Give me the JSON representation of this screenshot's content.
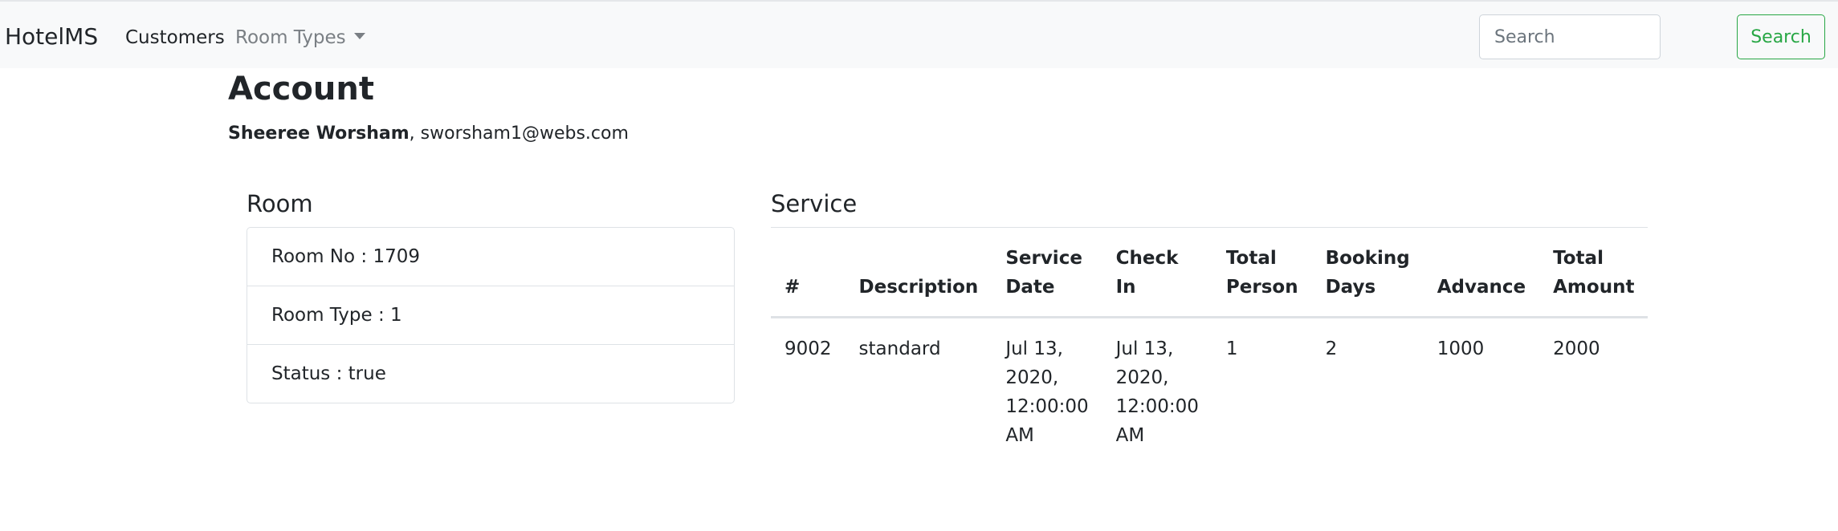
{
  "navbar": {
    "brand": "HotelMS",
    "links": [
      {
        "label": "Customers"
      },
      {
        "label": "Room Types"
      }
    ],
    "search": {
      "placeholder": "Search",
      "value": ""
    },
    "search_button": "Search",
    "colors": {
      "background": "#f8f9fa",
      "search_button": "#28a745"
    }
  },
  "page": {
    "title": "Account",
    "customer_name": "Sheeree Worsham",
    "separator": ", ",
    "customer_email": "sworsham1@webs.com"
  },
  "room": {
    "title": "Room",
    "items": [
      {
        "text": "Room No : 1709"
      },
      {
        "text": "Room Type : 1"
      },
      {
        "text": "Status : true"
      }
    ]
  },
  "service": {
    "title": "Service",
    "columns": [
      "#",
      "Description",
      "Service Date",
      "Check In",
      "Total Person",
      "Booking Days",
      "Advance",
      "Total Amount"
    ],
    "rows": [
      [
        "9002",
        "standard",
        "Jul 13, 2020, 12:00:00 AM",
        "Jul 13, 2020, 12:00:00 AM",
        "1",
        "2",
        "1000",
        "2000"
      ]
    ]
  }
}
